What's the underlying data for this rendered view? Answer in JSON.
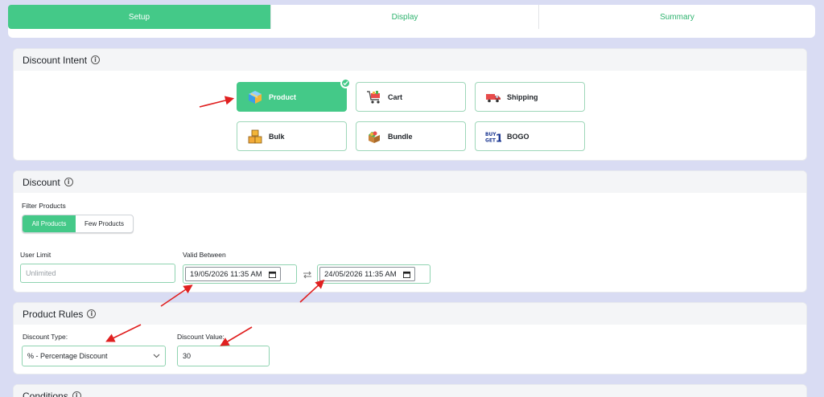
{
  "tabs": [
    {
      "label": "Setup",
      "active": true
    },
    {
      "label": "Display",
      "active": false
    },
    {
      "label": "Summary",
      "active": false
    }
  ],
  "intent": {
    "title": "Discount Intent",
    "options": [
      {
        "label": "Product",
        "icon": "box-icon",
        "selected": true
      },
      {
        "label": "Cart",
        "icon": "shopping-cart-icon",
        "selected": false
      },
      {
        "label": "Shipping",
        "icon": "truck-icon",
        "selected": false
      },
      {
        "label": "Bulk",
        "icon": "stacked-boxes-icon",
        "selected": false
      },
      {
        "label": "Bundle",
        "icon": "open-box-icon",
        "selected": false
      },
      {
        "label": "BOGO",
        "icon": "buy-get-icon",
        "selected": false
      }
    ]
  },
  "discount": {
    "title": "Discount",
    "filter_label": "Filter Products",
    "filter_options": [
      "All Products",
      "Few Products"
    ],
    "filter_selected": "All Products",
    "user_limit_label": "User Limit",
    "user_limit_placeholder": "Unlimited",
    "valid_between_label": "Valid Between",
    "start_date": "19/05/2026 11:35 AM",
    "end_date": "24/05/2026 11:35 AM"
  },
  "rules": {
    "title": "Product Rules",
    "type_label": "Discount Type:",
    "type_value": "% - Percentage Discount",
    "value_label": "Discount Value:",
    "value": "30"
  },
  "conditions": {
    "title": "Conditions"
  },
  "colors": {
    "accent": "#44c988",
    "annotation": "#e02020",
    "background": "#d9dcf3"
  }
}
